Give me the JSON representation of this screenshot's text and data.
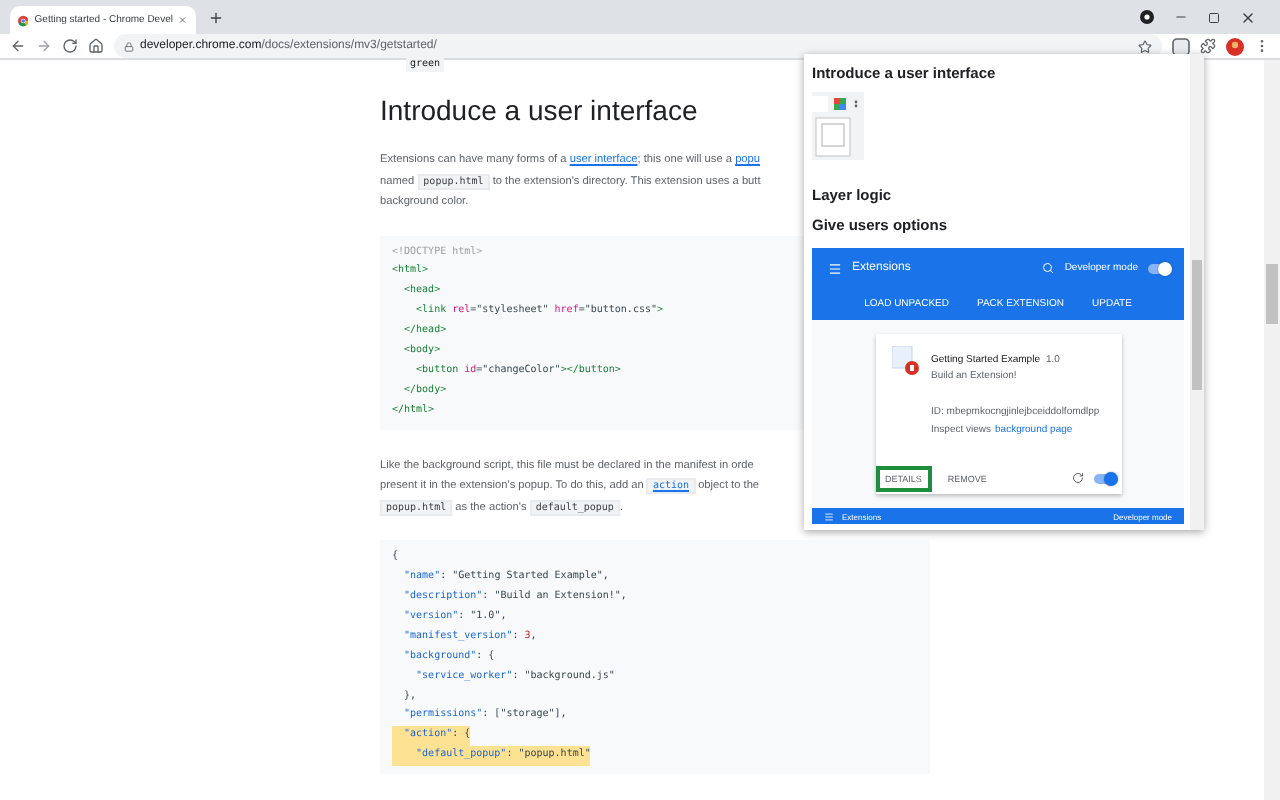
{
  "browser": {
    "tab_title": "Getting started - Chrome Devel",
    "url_domain": "developer.chrome.com",
    "url_path": "/docs/extensions/mv3/getstarted/"
  },
  "article": [
    {
      "kind": "inline_code",
      "text": "green"
    },
    {
      "kind": "heading",
      "text": "Introduce a user interface"
    },
    {
      "kind": "paragraph",
      "lines": [
        [
          {
            "kind": "text",
            "text": "Extensions can have many forms of a "
          },
          {
            "kind": "link",
            "text": "user interface"
          },
          {
            "kind": "text",
            "text": "; this one will use a "
          },
          {
            "kind": "link",
            "text": "popu"
          }
        ],
        [
          {
            "kind": "text",
            "text": "named "
          },
          {
            "kind": "code",
            "text": "popup.html"
          },
          {
            "kind": "text",
            "text": " to the extension's directory. This extension uses a butt"
          }
        ],
        [
          {
            "kind": "text",
            "text": "background color."
          }
        ]
      ]
    },
    {
      "kind": "code_block",
      "lines": [
        {
          "highlighted": false,
          "tokens": [
            {
              "kind": "comment",
              "text": "<!DOCTYPE html>"
            }
          ]
        },
        {
          "highlighted": false,
          "tokens": [
            {
              "kind": "tag",
              "text": "<html>"
            }
          ]
        },
        {
          "highlighted": false,
          "tokens": [
            {
              "kind": "tag",
              "text": "  <head>"
            }
          ]
        },
        {
          "highlighted": false,
          "tokens": [
            {
              "kind": "tag",
              "text": "    <link"
            },
            {
              "kind": "attr",
              "text": " rel"
            },
            {
              "kind": "plain",
              "text": "="
            },
            {
              "kind": "string",
              "text": "\"stylesheet\""
            },
            {
              "kind": "attr",
              "text": " href"
            },
            {
              "kind": "plain",
              "text": "="
            },
            {
              "kind": "string",
              "text": "\"button.css\""
            },
            {
              "kind": "tag",
              "text": ">"
            }
          ]
        },
        {
          "highlighted": false,
          "tokens": [
            {
              "kind": "tag",
              "text": "  </head>"
            }
          ]
        },
        {
          "highlighted": false,
          "tokens": [
            {
              "kind": "tag",
              "text": "  <body>"
            }
          ]
        },
        {
          "highlighted": false,
          "tokens": [
            {
              "kind": "tag",
              "text": "    <button"
            },
            {
              "kind": "attr",
              "text": " id"
            },
            {
              "kind": "plain",
              "text": "="
            },
            {
              "kind": "string",
              "text": "\"changeColor\""
            },
            {
              "kind": "tag",
              "text": "></button>"
            }
          ]
        },
        {
          "highlighted": false,
          "tokens": [
            {
              "kind": "tag",
              "text": "  </body>"
            }
          ]
        },
        {
          "highlighted": false,
          "tokens": [
            {
              "kind": "tag",
              "text": "</html>"
            }
          ]
        }
      ]
    },
    {
      "kind": "paragraph",
      "lines": [
        [
          {
            "kind": "text",
            "text": "Like the background script, this file must be declared in the manifest in orde"
          }
        ],
        [
          {
            "kind": "text",
            "text": "present it in the extension's popup. To do this, add an "
          },
          {
            "kind": "code_link",
            "text": "action"
          },
          {
            "kind": "text",
            "text": " object to the"
          }
        ],
        [
          {
            "kind": "code",
            "text": "popup.html"
          },
          {
            "kind": "text",
            "text": " as the action's "
          },
          {
            "kind": "code",
            "text": "default_popup"
          },
          {
            "kind": "text",
            "text": "."
          }
        ]
      ]
    },
    {
      "kind": "code_block",
      "lines": [
        {
          "highlighted": false,
          "tokens": [
            {
              "kind": "plain",
              "text": "{"
            }
          ]
        },
        {
          "highlighted": false,
          "tokens": [
            {
              "kind": "key",
              "text": "  \"name\""
            },
            {
              "kind": "plain",
              "text": ": "
            },
            {
              "kind": "string",
              "text": "\"Getting Started Example\""
            },
            {
              "kind": "plain",
              "text": ","
            }
          ]
        },
        {
          "highlighted": false,
          "tokens": [
            {
              "kind": "key",
              "text": "  \"description\""
            },
            {
              "kind": "plain",
              "text": ": "
            },
            {
              "kind": "string",
              "text": "\"Build an Extension!\""
            },
            {
              "kind": "plain",
              "text": ","
            }
          ]
        },
        {
          "highlighted": false,
          "tokens": [
            {
              "kind": "key",
              "text": "  \"version\""
            },
            {
              "kind": "plain",
              "text": ": "
            },
            {
              "kind": "string",
              "text": "\"1.0\""
            },
            {
              "kind": "plain",
              "text": ","
            }
          ]
        },
        {
          "highlighted": false,
          "tokens": [
            {
              "kind": "key",
              "text": "  \"manifest_version\""
            },
            {
              "kind": "plain",
              "text": ": "
            },
            {
              "kind": "number",
              "text": "3"
            },
            {
              "kind": "plain",
              "text": ","
            }
          ]
        },
        {
          "highlighted": false,
          "tokens": [
            {
              "kind": "key",
              "text": "  \"background\""
            },
            {
              "kind": "plain",
              "text": ": {"
            }
          ]
        },
        {
          "highlighted": false,
          "tokens": [
            {
              "kind": "key",
              "text": "    \"service_worker\""
            },
            {
              "kind": "plain",
              "text": ": "
            },
            {
              "kind": "string",
              "text": "\"background.js\""
            }
          ]
        },
        {
          "highlighted": false,
          "tokens": [
            {
              "kind": "plain",
              "text": "  },"
            }
          ]
        },
        {
          "highlighted": false,
          "tokens": [
            {
              "kind": "key",
              "text": "  \"permissions\""
            },
            {
              "kind": "plain",
              "text": ": ["
            },
            {
              "kind": "string",
              "text": "\"storage\""
            },
            {
              "kind": "plain",
              "text": "],"
            }
          ]
        },
        {
          "highlighted": true,
          "tokens": [
            {
              "kind": "key",
              "text": "  \"action\""
            },
            {
              "kind": "plain",
              "text": ": {"
            }
          ]
        },
        {
          "highlighted": true,
          "tokens": [
            {
              "kind": "key",
              "text": "    \"default_popup\""
            },
            {
              "kind": "plain",
              "text": ": "
            },
            {
              "kind": "string",
              "text": "\"popup.html\""
            }
          ]
        }
      ]
    }
  ],
  "popup": {
    "items": [
      {
        "kind": "heading",
        "text": "Introduce a user interface"
      },
      {
        "kind": "preview"
      },
      {
        "kind": "heading",
        "text": "Layer logic"
      },
      {
        "kind": "heading",
        "text": "Give users options"
      },
      {
        "kind": "screenshot",
        "title": "Extensions",
        "developer_mode": "Developer mode",
        "developer_mode_on": true,
        "actions": [
          "LOAD UNPACKED",
          "PACK EXTENSION",
          "UPDATE"
        ],
        "card": {
          "name": "Getting Started Example",
          "version": "1.0",
          "description": "Build an Extension!",
          "id": "ID: mbepmkocngjinlejbceiddolfomdlpp",
          "inspect_label": "Inspect views",
          "inspect_link": "background page",
          "buttons": [
            {
              "label": "DETAILS",
              "selected": true
            },
            {
              "label": "REMOVE",
              "selected": false
            }
          ],
          "enabled": true
        },
        "footer": {
          "title": "Extensions",
          "developer_mode": "Developer mode"
        }
      }
    ]
  }
}
